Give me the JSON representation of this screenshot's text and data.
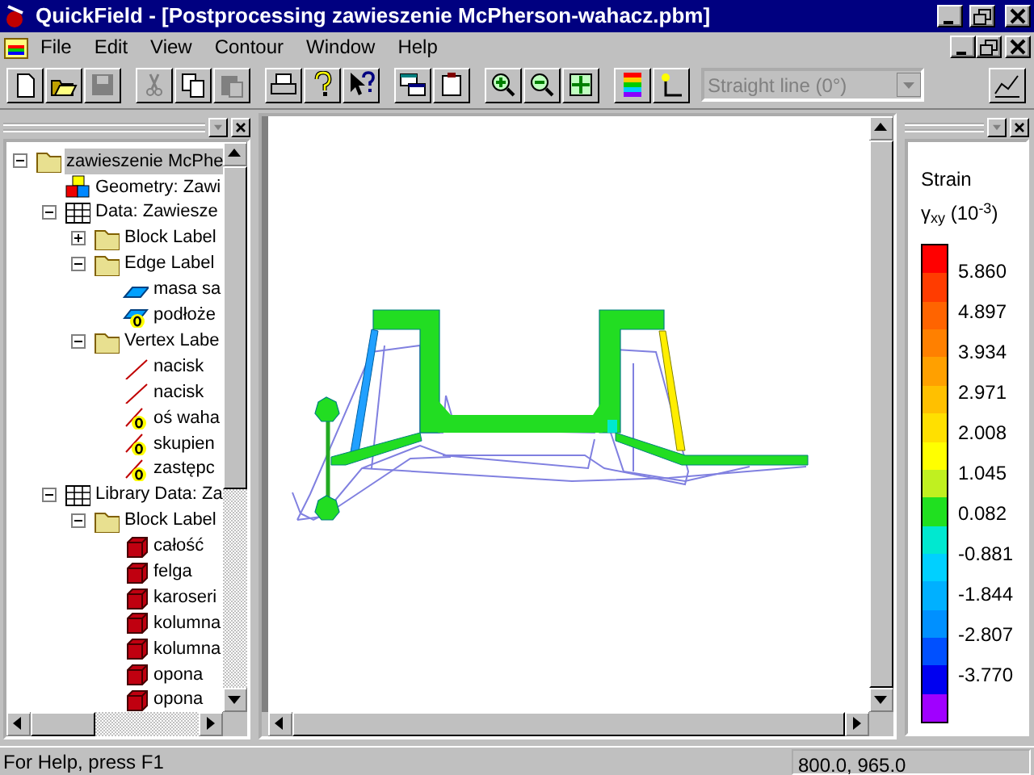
{
  "window": {
    "title": "QuickField - [Postprocessing zawieszenie McPherson-wahacz.pbm]"
  },
  "menu": [
    "File",
    "Edit",
    "View",
    "Contour",
    "Window",
    "Help"
  ],
  "toolbar": {
    "combo": {
      "value": "Straight line (0°)",
      "disabled": true
    }
  },
  "tree": [
    {
      "label": "zawieszenie McPhe",
      "kind": "folder",
      "expanded": true,
      "selected": true,
      "children": [
        {
          "label": "Geometry: Zawi",
          "kind": "geometry",
          "selected": false
        },
        {
          "label": "Data: Zawiesze",
          "kind": "table",
          "expanded": true,
          "selected": false,
          "children": [
            {
              "label": "Block Label",
              "kind": "folder",
              "expanded": false,
              "selected": false
            },
            {
              "label": "Edge Label",
              "kind": "folder",
              "expanded": true,
              "selected": false,
              "children": [
                {
                  "label": "masa sa",
                  "kind": "edge",
                  "selected": false
                },
                {
                  "label": "podłoże",
                  "kind": "edgezero",
                  "selected": false
                }
              ]
            },
            {
              "label": "Vertex Labe",
              "kind": "folder",
              "expanded": true,
              "selected": false,
              "children": [
                {
                  "label": "nacisk",
                  "kind": "vertex",
                  "selected": false
                },
                {
                  "label": "nacisk",
                  "kind": "vertex",
                  "selected": false
                },
                {
                  "label": "oś waha",
                  "kind": "vertexzero",
                  "selected": false
                },
                {
                  "label": "skupien",
                  "kind": "vertexzero",
                  "selected": false
                },
                {
                  "label": "zastępc",
                  "kind": "vertexzero",
                  "selected": false
                }
              ]
            }
          ]
        },
        {
          "label": "Library Data: Za",
          "kind": "table",
          "expanded": true,
          "selected": false,
          "children": [
            {
              "label": "Block Label",
              "kind": "folder",
              "expanded": true,
              "selected": false,
              "children": [
                {
                  "label": "całość",
                  "kind": "block",
                  "selected": false
                },
                {
                  "label": "felga",
                  "kind": "block",
                  "selected": false
                },
                {
                  "label": "karoseri",
                  "kind": "block",
                  "selected": false
                },
                {
                  "label": "kolumna",
                  "kind": "block",
                  "selected": false
                },
                {
                  "label": "kolumna",
                  "kind": "block",
                  "selected": false
                },
                {
                  "label": "opona",
                  "kind": "block",
                  "selected": false
                },
                {
                  "label": "opona",
                  "kind": "block",
                  "selected": false
                }
              ]
            }
          ]
        }
      ]
    }
  ],
  "legend": {
    "title": "Strain",
    "quantity": "γ$_{xy}$ (10$^{-3}$)",
    "bands": [
      {
        "color": "#ff0000"
      },
      {
        "color": "#ff3c00"
      },
      {
        "color": "#ff6400"
      },
      {
        "color": "#ff8000"
      },
      {
        "color": "#ffa000"
      },
      {
        "color": "#ffc000"
      },
      {
        "color": "#ffe000"
      },
      {
        "color": "#ffff00"
      },
      {
        "color": "#c0f020"
      },
      {
        "color": "#20e020"
      },
      {
        "color": "#00e8d0"
      },
      {
        "color": "#00d0ff"
      },
      {
        "color": "#00b0ff"
      },
      {
        "color": "#0090ff"
      },
      {
        "color": "#0050ff"
      },
      {
        "color": "#0000f0"
      },
      {
        "color": "#a000ff"
      }
    ],
    "labels": [
      "5.860",
      "4.897",
      "3.934",
      "2.971",
      "2.008",
      "1.045",
      "0.082",
      "-0.881",
      "-1.844",
      "-2.807",
      "-3.770"
    ]
  },
  "status_bar": {
    "message": "For Help, press F1",
    "coordinates": "800.0, 965.0"
  }
}
